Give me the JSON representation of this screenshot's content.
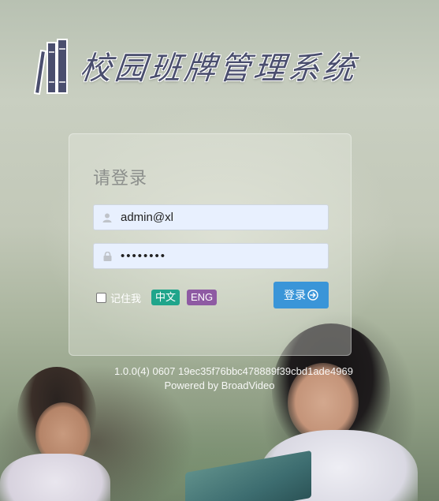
{
  "header": {
    "title": "校园班牌管理系统",
    "logo_icon": "books-icon"
  },
  "login": {
    "heading": "请登录",
    "username": {
      "value": "admin@xl",
      "icon": "user-icon"
    },
    "password": {
      "value": "••••••••",
      "icon": "lock-icon"
    },
    "remember_label": "记住我",
    "remember_checked": false,
    "lang_zh": "中文",
    "lang_en": "ENG",
    "submit_label": "登录",
    "submit_icon": "arrow-right-circle-icon"
  },
  "footer": {
    "version": "1.0.0(4) 0607 19ec35f76bbc478889f39cbd1ade4969",
    "powered_by": "Powered by BroadVideo"
  },
  "colors": {
    "title": "#4a4e6e",
    "input_bg": "#e8f0fe",
    "zh_badge": "#1fa58b",
    "en_badge": "#8e5aa3",
    "login_button": "#3a95d8"
  }
}
